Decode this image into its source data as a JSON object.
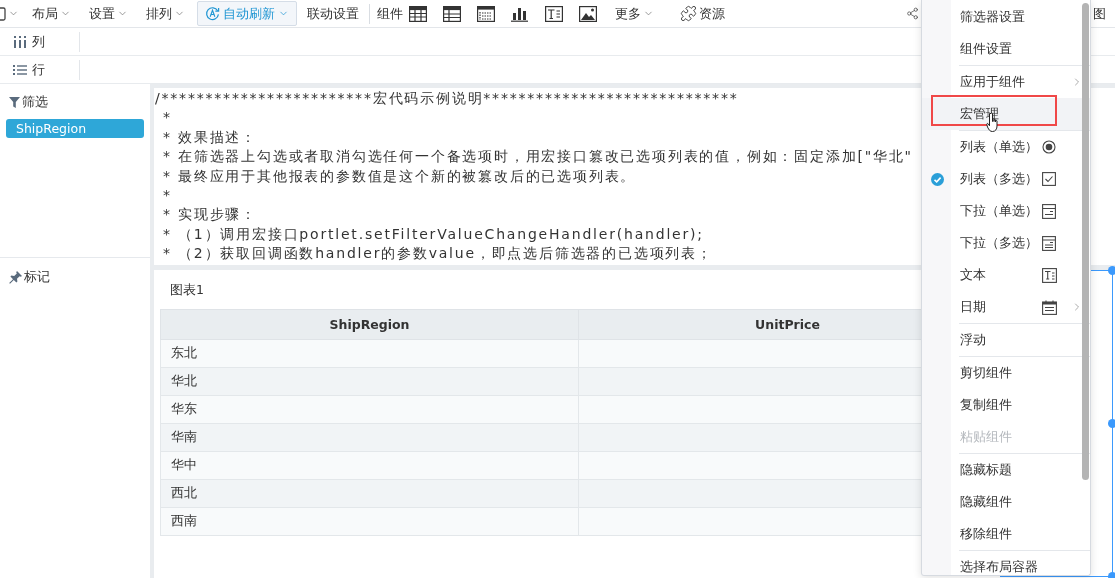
{
  "toolbar": {
    "view_menus": [
      {
        "label": "布局"
      },
      {
        "label": "设置"
      },
      {
        "label": "排列"
      }
    ],
    "auto_refresh": {
      "label": "自动刷新",
      "on": true
    },
    "linkage_button": "联动设置",
    "components_label": "组件",
    "more_menu": "更多",
    "resources_button": "资源",
    "right_text": "图"
  },
  "shelves": [
    {
      "kind": "columns",
      "label": "列"
    },
    {
      "kind": "rows",
      "label": "行"
    }
  ],
  "left_panel": {
    "filter_title": "筛选",
    "filter_fields": [
      "ShipRegion"
    ],
    "marks_title": "标记"
  },
  "code_panel": {
    "lines": [
      "/************************宏代码示例说明*****************************",
      "*",
      "* 效果描述：",
      "* 在筛选器上勾选或者取消勾选任何一个备选项时，用宏接口篡改已选项列表的值，例如：固定添加[\"华北\"",
      "* 最终应用于其他报表的参数值是这个新的被篡改后的已选项列表。",
      "*",
      "* 实现步骤：",
      "* （1）调用宏接口portlet.setFilterValueChangeHandler(handler);",
      "* （2）获取回调函数handler的参数value，即点选后筛选器的已选项列表；"
    ]
  },
  "component": {
    "title": "图表1",
    "table": {
      "columns": [
        "ShipRegion",
        "UnitPrice"
      ],
      "rows": [
        [
          "东北"
        ],
        [
          "华北"
        ],
        [
          "华东"
        ],
        [
          "华南"
        ],
        [
          "华中"
        ],
        [
          "西北"
        ],
        [
          "西南"
        ]
      ]
    }
  },
  "selected_widget": {
    "selected": true
  },
  "context_menu": {
    "sections": [
      {
        "items": [
          {
            "label": "筛选器设置",
            "kind": "action",
            "submenu": false,
            "disabled": false,
            "hovered": false,
            "annotated": false
          },
          {
            "label": "组件设置",
            "kind": "action",
            "submenu": false,
            "disabled": false,
            "hovered": false,
            "annotated": false
          }
        ]
      },
      {
        "items": [
          {
            "label": "应用于组件",
            "kind": "action",
            "submenu": true,
            "disabled": false,
            "hovered": false,
            "annotated": false
          },
          {
            "label": "宏管理",
            "kind": "action",
            "submenu": false,
            "disabled": false,
            "hovered": true,
            "annotated": true
          }
        ]
      },
      {
        "items": [
          {
            "label": "列表（单选）",
            "kind": "list_single",
            "selected": false,
            "submenu": false,
            "disabled": false,
            "hovered": false,
            "annotated": false
          },
          {
            "label": "列表（多选）",
            "kind": "list_multi",
            "selected": true,
            "submenu": false,
            "disabled": false,
            "hovered": false,
            "annotated": false
          },
          {
            "label": "下拉（单选）",
            "kind": "dropdown_single",
            "selected": false,
            "submenu": false,
            "disabled": false,
            "hovered": false,
            "annotated": false
          },
          {
            "label": "下拉（多选）",
            "kind": "dropdown_multi",
            "selected": false,
            "submenu": false,
            "disabled": false,
            "hovered": false,
            "annotated": false
          },
          {
            "label": "文本",
            "kind": "text",
            "selected": false,
            "submenu": false,
            "disabled": false,
            "hovered": false,
            "annotated": false
          },
          {
            "label": "日期",
            "kind": "date",
            "selected": false,
            "submenu": true,
            "disabled": false,
            "hovered": false,
            "annotated": false
          }
        ]
      },
      {
        "items": [
          {
            "label": "浮动",
            "kind": "action",
            "submenu": false,
            "disabled": false,
            "hovered": false,
            "annotated": false
          }
        ]
      },
      {
        "items": [
          {
            "label": "剪切组件",
            "kind": "action",
            "submenu": false,
            "disabled": false,
            "hovered": false,
            "annotated": false
          },
          {
            "label": "复制组件",
            "kind": "action",
            "submenu": false,
            "disabled": false,
            "hovered": false,
            "annotated": false
          },
          {
            "label": "粘贴组件",
            "kind": "action",
            "submenu": false,
            "disabled": true,
            "hovered": false,
            "annotated": false
          }
        ]
      },
      {
        "items": [
          {
            "label": "隐藏标题",
            "kind": "action",
            "submenu": false,
            "disabled": false,
            "hovered": false,
            "annotated": false
          },
          {
            "label": "隐藏组件",
            "kind": "action",
            "submenu": false,
            "disabled": false,
            "hovered": false,
            "annotated": false
          },
          {
            "label": "移除组件",
            "kind": "action",
            "submenu": false,
            "disabled": false,
            "hovered": false,
            "annotated": false
          }
        ]
      },
      {
        "items": [
          {
            "label": "选择布局容器",
            "kind": "action",
            "submenu": false,
            "disabled": false,
            "hovered": false,
            "annotated": false
          }
        ]
      }
    ]
  }
}
